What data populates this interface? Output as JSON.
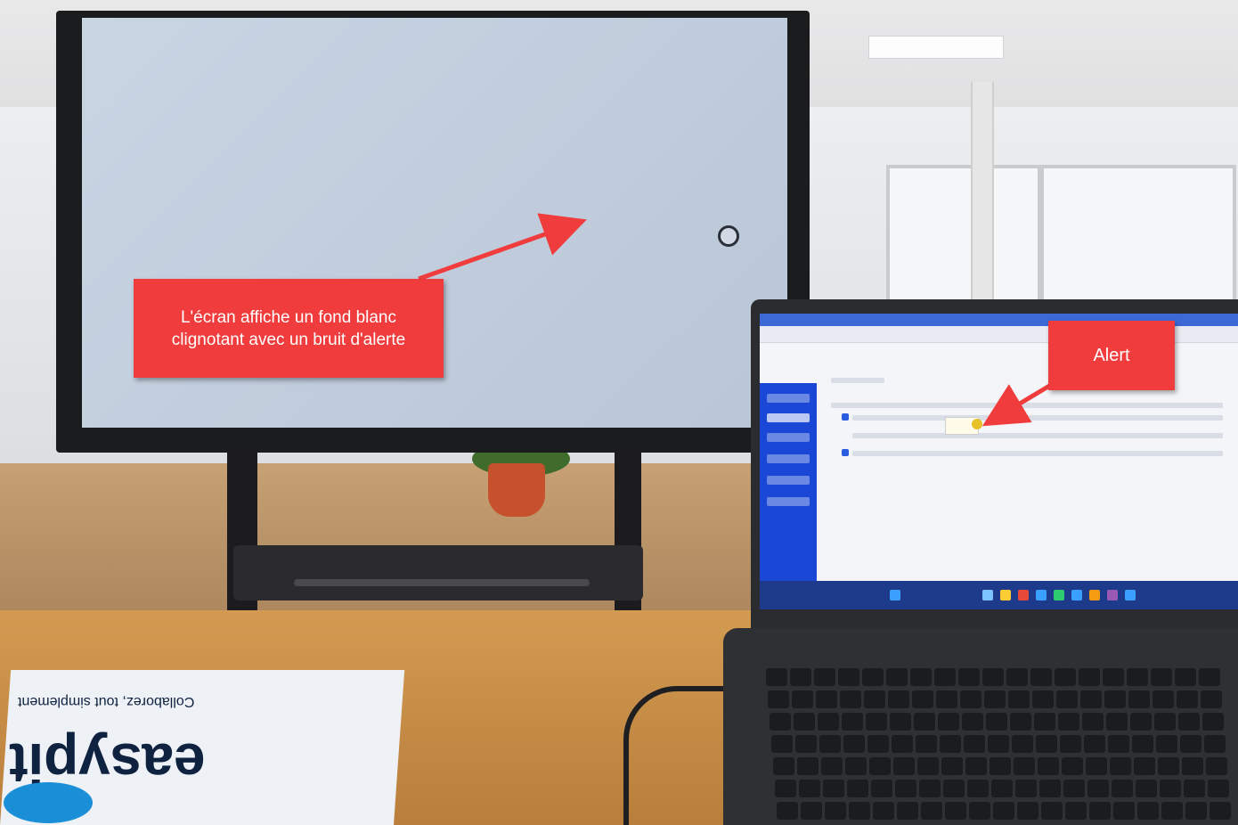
{
  "callouts": {
    "tv_note": "L'écran affiche un fond blanc clignotant avec un bruit d'alerte",
    "laptop_note": "Alert"
  },
  "paper": {
    "brand_text": "easypit",
    "tagline": "Collaborez, tout simplement"
  },
  "colors": {
    "callout": "#f03c3c",
    "app_sidebar": "#1b47d6",
    "tv_screen": "#c9d5e3"
  }
}
